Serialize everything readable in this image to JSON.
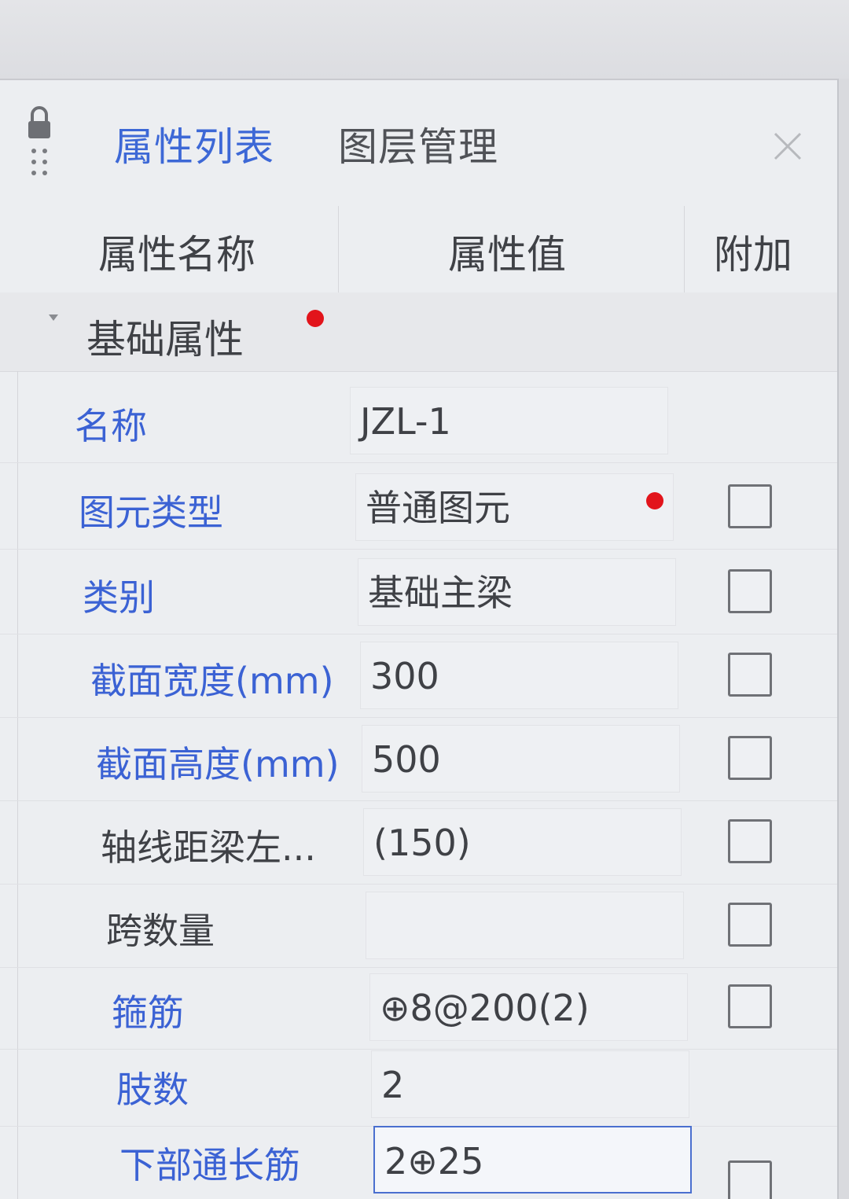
{
  "tabs": [
    {
      "label": "属性列表"
    },
    {
      "label": "图层管理"
    }
  ],
  "columns": {
    "name": "属性名称",
    "value": "属性值",
    "extra": "附加"
  },
  "group": {
    "label": "基础属性"
  },
  "rows": [
    {
      "name": "名称",
      "value": "JZL-1"
    },
    {
      "name": "图元类型",
      "value": "普通图元"
    },
    {
      "name": "类别",
      "value": "基础主梁"
    },
    {
      "name": "截面宽度(mm)",
      "value": "300"
    },
    {
      "name": "截面高度(mm)",
      "value": "500"
    },
    {
      "name": "轴线距梁左...",
      "value": "(150)"
    },
    {
      "name": "跨数量",
      "value": ""
    },
    {
      "name": "箍筋",
      "value": "⊕8@200(2)"
    },
    {
      "name": "肢数",
      "value": "2"
    },
    {
      "name": "下部通长筋",
      "value": "2⊕25"
    }
  ],
  "colors": {
    "accent_blue": "#3d68d6",
    "required_dot": "#e2141b"
  },
  "icons": [
    "lock-icon",
    "drag-handle-icon",
    "close-icon",
    "collapse-arrow-icon"
  ]
}
